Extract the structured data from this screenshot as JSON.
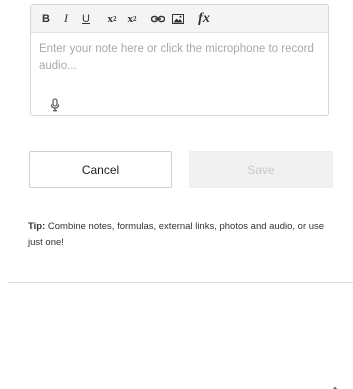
{
  "editor": {
    "toolbar": {
      "bold": "B",
      "italic": "I",
      "underline": "U",
      "superscript_base": "x",
      "superscript_mark": "2",
      "subscript_base": "x",
      "subscript_mark": "2",
      "link_icon": "link-icon",
      "image_icon": "image-icon",
      "formula": "fx"
    },
    "placeholder": "Enter your note here or click the microphone to record audio...",
    "mic_icon": "microphone-icon"
  },
  "actions": {
    "cancel_label": "Cancel",
    "save_label": "Save"
  },
  "tip": {
    "label": "Tip:",
    "text": " Combine notes, formulas, external links, photos and audio, or use just one!"
  },
  "colors": {
    "toolbar_bg": "#f4f4f4",
    "placeholder": "#a8a8a8",
    "save_disabled_bg": "#f1f1f1",
    "save_disabled_text": "#c9c9c9"
  }
}
